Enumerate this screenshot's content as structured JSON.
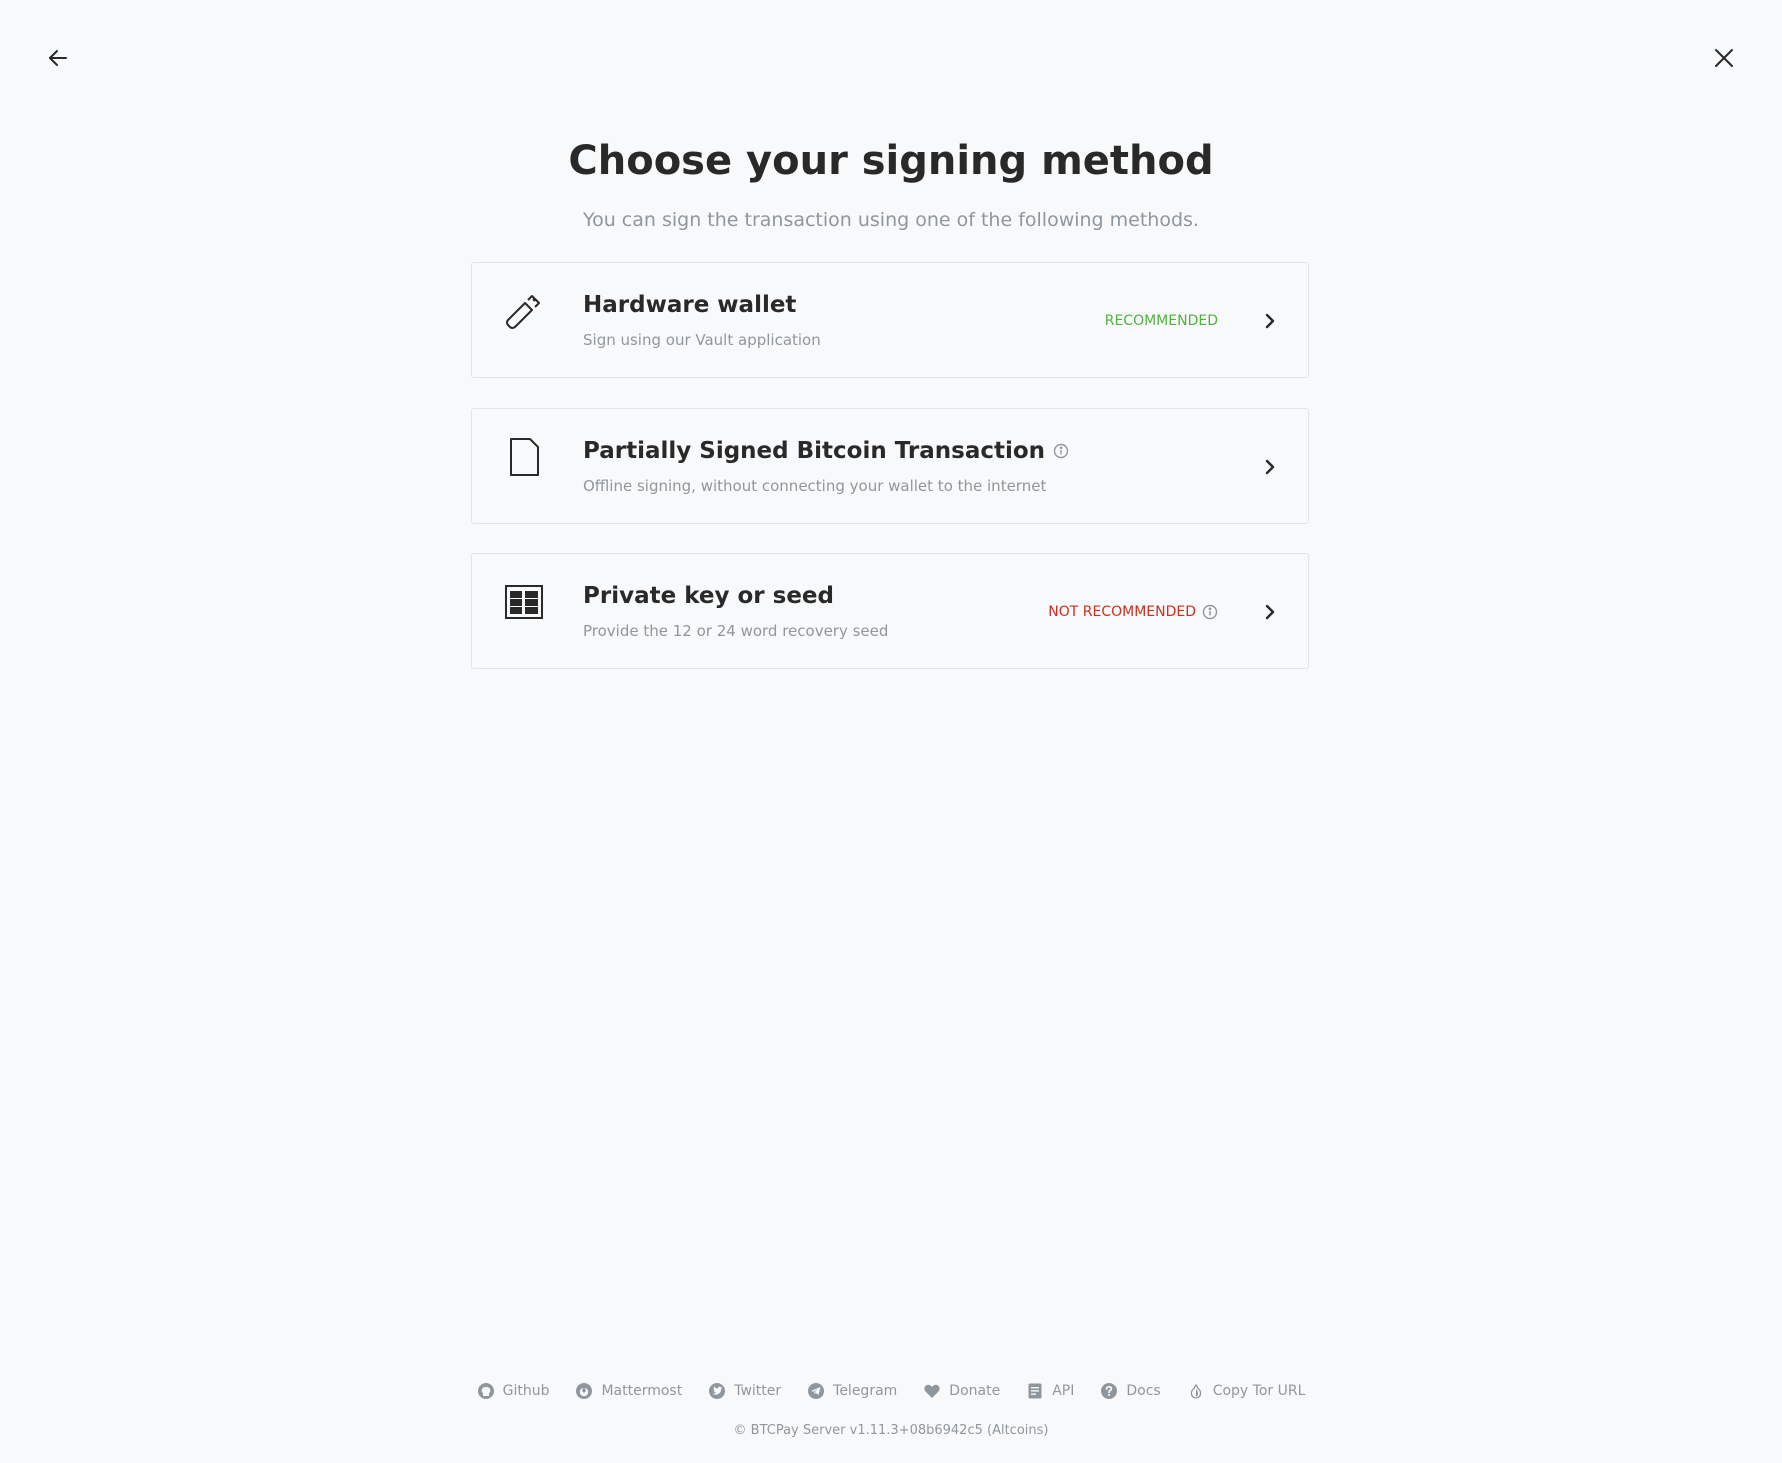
{
  "header": {
    "back_icon": "arrow-left-icon",
    "close_icon": "close-icon",
    "title": "Choose your signing method",
    "subtitle": "You can sign the transaction using one of the following methods."
  },
  "methods": [
    {
      "icon": "hardware-wallet-icon",
      "title": "Hardware wallet",
      "description": "Sign using our Vault application",
      "badge": "RECOMMENDED",
      "badge_color": "#51b13e"
    },
    {
      "icon": "document-icon",
      "title": "Partially Signed Bitcoin Transaction",
      "description": "Offline signing, without connecting your wallet to the internet",
      "badge": ""
    },
    {
      "icon": "seed-grid-icon",
      "title": "Private key or seed",
      "description": "Provide the 12 or 24 word recovery seed",
      "badge": "NOT RECOMMENDED",
      "badge_color": "#cc2f1e"
    }
  ],
  "footer": {
    "links": [
      {
        "label": "Github",
        "icon": "github-icon"
      },
      {
        "label": "Mattermost",
        "icon": "mattermost-icon"
      },
      {
        "label": "Twitter",
        "icon": "twitter-icon"
      },
      {
        "label": "Telegram",
        "icon": "telegram-icon"
      },
      {
        "label": "Donate",
        "icon": "heart-icon"
      },
      {
        "label": "API",
        "icon": "api-doc-icon"
      },
      {
        "label": "Docs",
        "icon": "question-icon"
      },
      {
        "label": "Copy Tor URL",
        "icon": "tor-onion-icon"
      }
    ],
    "copyright": "© BTCPay Server v1.11.3+08b6942c5 (Altcoins)"
  },
  "colors": {
    "background": "#f8f9fa",
    "text": "#292929",
    "muted": "#8f979e",
    "border": "#e1e4e8"
  }
}
